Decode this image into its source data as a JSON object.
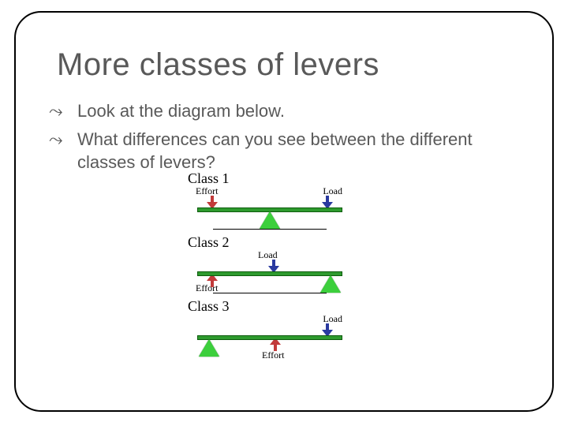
{
  "title": "More classes of levers",
  "bullets": {
    "b1": "Look at the diagram below.",
    "b2": "What differences can you see between the different classes of levers?"
  },
  "bullet_sym": "⤳",
  "diagram": {
    "c1": {
      "title": "Class 1",
      "effort": "Effort",
      "load": "Load"
    },
    "c2": {
      "title": "Class 2",
      "effort": "Effort",
      "load": "Load"
    },
    "c3": {
      "title": "Class 3",
      "effort": "Effort",
      "load": "Load"
    }
  }
}
